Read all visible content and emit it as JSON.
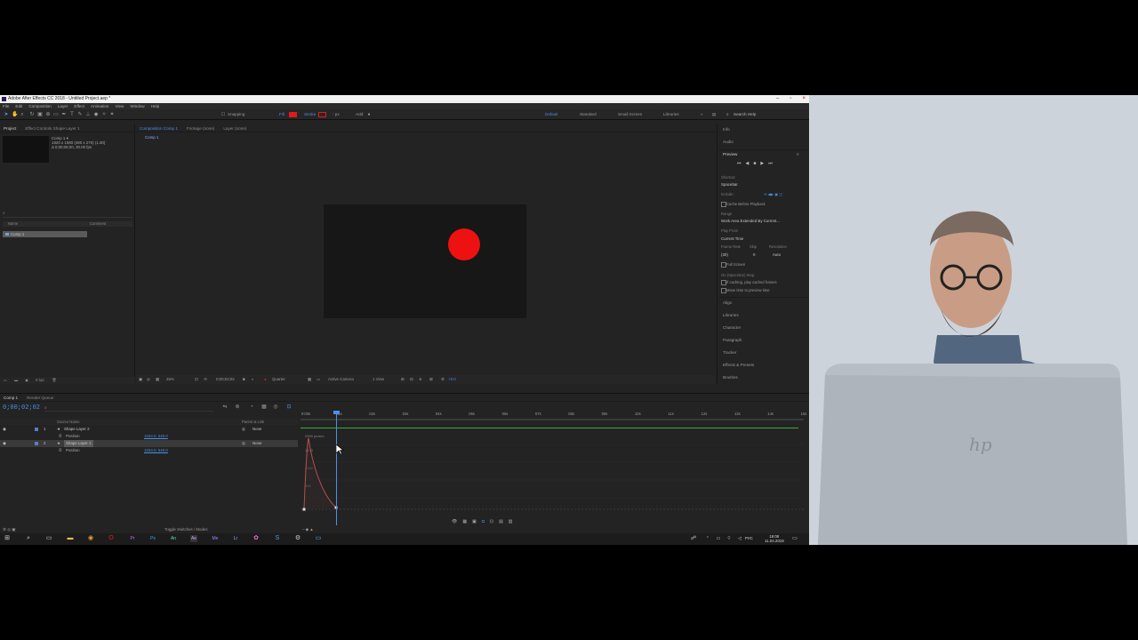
{
  "window": {
    "title": "Adobe After Effects CC 2018 - Untitled Project.aep *"
  },
  "menu": [
    "File",
    "Edit",
    "Composition",
    "Layer",
    "Effect",
    "Animation",
    "View",
    "Window",
    "Help"
  ],
  "toolbar": {
    "snapping": "Snapping",
    "fill": "Fill",
    "stroke": "Stroke",
    "stroke_px": "- px",
    "add": "Add:",
    "fill_color": "#e21a1a",
    "stroke_color": "#e21a1a",
    "workspaces": [
      "Default",
      "Standard",
      "Small Screen",
      "Libraries"
    ],
    "search_help": "Search Help"
  },
  "project": {
    "tabs": [
      "Project",
      "Effect Controls Shape Layer 1"
    ],
    "comp_name": "Comp 1 ▾",
    "comp_info": [
      "1920 x 1080 (480 x 270) (1.00)",
      "Δ 0;00;05;00, 30.00 fps"
    ],
    "columns": [
      "Name",
      "Comment"
    ],
    "item": "Comp 1",
    "footer": [
      "8 bpc"
    ]
  },
  "composition": {
    "tabs": [
      "Composition Comp 1",
      "Footage (none)",
      "Layer (none)"
    ],
    "crumb": "Comp 1",
    "accent": "#ee1111",
    "viewer": {
      "zoom": "25%",
      "timecode": "0;00;02;02",
      "resolution": "Quarter",
      "camera": "Active Camera",
      "views": "1 View",
      "exposure": "+0.0"
    }
  },
  "right": {
    "info": "Info",
    "audio": "Audio",
    "preview": "Preview",
    "shortcut_label": "Shortcut",
    "shortcut": "Spacebar",
    "include_label": "Include:",
    "cache": "Cache Before Playback",
    "range_label": "Range",
    "range": "Work Area Extended By Current...",
    "play_from_label": "Play From",
    "play_from": "Current Time",
    "fps_labels": [
      "Frame Rate",
      "Skip",
      "Resolution"
    ],
    "fps_values": [
      "(30)",
      "0",
      "Auto"
    ],
    "full_screen": "Full Screen",
    "on_stop": "On (Spacebar) Stop:",
    "if_caching": "If caching, play cached frames",
    "move_time": "Move time to preview time",
    "panels": [
      "Align",
      "Libraries",
      "Character",
      "Paragraph",
      "Tracker",
      "Effects & Presets",
      "Brushes"
    ]
  },
  "timeline": {
    "tabs": [
      "Comp 1",
      "Render Queue"
    ],
    "timecode": "0;00;02;02",
    "columns": {
      "source": "Source Name",
      "parent": "Parent & Link"
    },
    "layers": [
      {
        "num": "1",
        "name": "Shape Layer 2",
        "mode": "None",
        "prop": "Position",
        "value": "1034.0, 540.0"
      },
      {
        "num": "2",
        "name": "Shape Layer 1",
        "mode": "None",
        "prop": "Position",
        "value": "1034.0, 540.0"
      }
    ],
    "ruler": [
      "0:00s",
      "01s",
      "02s",
      "03s",
      "04s",
      "05s",
      "06s",
      "07s",
      "08s",
      "09s",
      "10s",
      "11s",
      "12s",
      "13s",
      "14s",
      "15s"
    ],
    "graph_labels": [
      "2000 px/sec",
      "1500",
      "1000",
      "500"
    ],
    "footer": "Toggle Switches / Modes"
  },
  "taskbar": {
    "lang": "РУС",
    "time": "19:08",
    "date": "11.04.2019"
  }
}
